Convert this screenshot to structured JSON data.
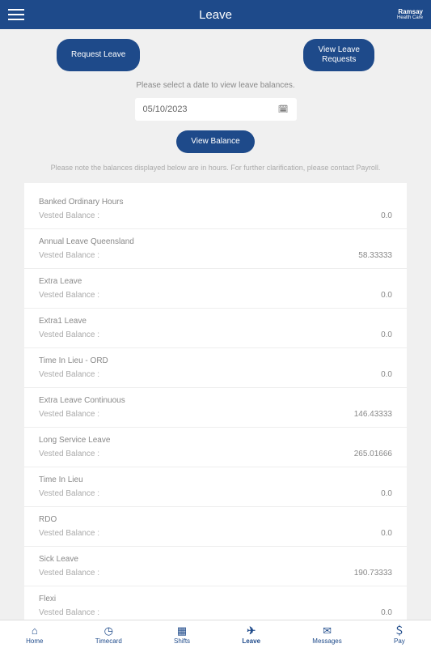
{
  "header": {
    "title": "Leave",
    "logo": "Ramsay",
    "logo_sub": "Health Care"
  },
  "buttons": {
    "request": "Request Leave",
    "viewRequests": "View Leave\nRequests",
    "viewBalance": "View Balance"
  },
  "hint": "Please select a date to view leave balances.",
  "date": "05/10/2023",
  "note": "Please note the balances displayed below are in hours. For further clarification, please contact Payroll.",
  "vestedLabel": "Vested Balance :",
  "balances": [
    {
      "name": "Banked Ordinary Hours",
      "value": "0.0"
    },
    {
      "name": "Annual Leave Queensland",
      "value": "58.33333"
    },
    {
      "name": "Extra Leave",
      "value": "0.0"
    },
    {
      "name": "Extra1 Leave",
      "value": "0.0"
    },
    {
      "name": "Time In Lieu - ORD",
      "value": "0.0"
    },
    {
      "name": "Extra Leave Continuous",
      "value": "146.43333"
    },
    {
      "name": "Long Service Leave",
      "value": "265.01666"
    },
    {
      "name": "Time In Lieu",
      "value": "0.0"
    },
    {
      "name": "RDO",
      "value": "0.0"
    },
    {
      "name": "Sick Leave",
      "value": "190.73333"
    },
    {
      "name": "Flexi",
      "value": "0.0"
    }
  ],
  "tabs": [
    {
      "icon": "⌂",
      "label": "Home"
    },
    {
      "icon": "◷",
      "label": "Timecard"
    },
    {
      "icon": "▦",
      "label": "Shifts"
    },
    {
      "icon": "✈",
      "label": "Leave"
    },
    {
      "icon": "✉",
      "label": "Messages"
    },
    {
      "icon": "＄",
      "label": "Pay"
    }
  ],
  "activeTab": 3
}
